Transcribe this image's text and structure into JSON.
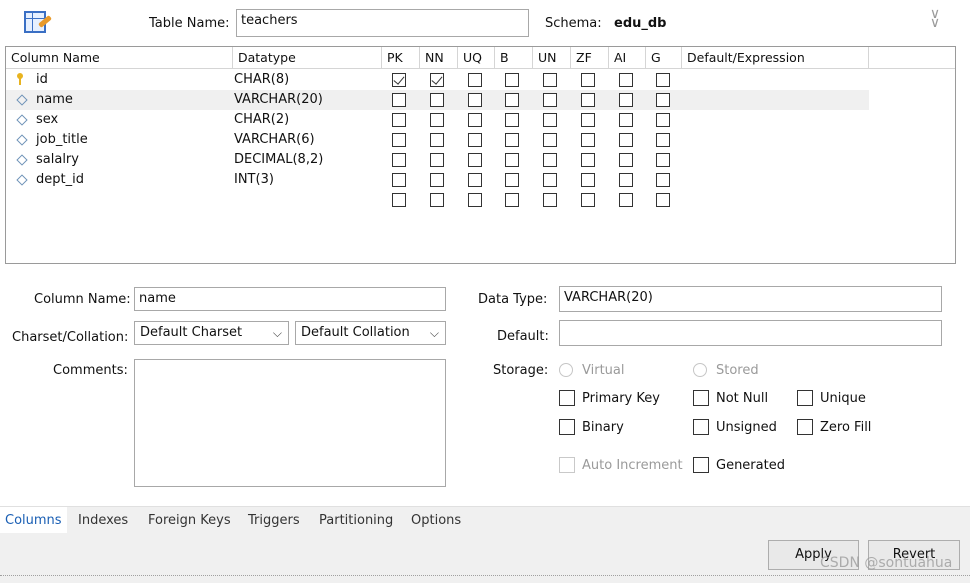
{
  "header": {
    "table_name_label": "Table Name:",
    "table_name_value": "teachers",
    "schema_label": "Schema:",
    "schema_value": "edu_db"
  },
  "grid": {
    "headers": [
      "Column Name",
      "Datatype",
      "PK",
      "NN",
      "UQ",
      "B",
      "UN",
      "ZF",
      "AI",
      "G",
      "Default/Expression"
    ],
    "rows": [
      {
        "icon": "key-icon",
        "name": "id",
        "type": "CHAR(8)",
        "flags": [
          true,
          true,
          false,
          false,
          false,
          false,
          false,
          false
        ]
      },
      {
        "icon": "diamond-icon",
        "name": "name",
        "type": "VARCHAR(20)",
        "flags": [
          false,
          false,
          false,
          false,
          false,
          false,
          false,
          false
        ]
      },
      {
        "icon": "diamond-icon",
        "name": "sex",
        "type": "CHAR(2)",
        "flags": [
          false,
          false,
          false,
          false,
          false,
          false,
          false,
          false
        ]
      },
      {
        "icon": "diamond-icon",
        "name": "job_title",
        "type": "VARCHAR(6)",
        "flags": [
          false,
          false,
          false,
          false,
          false,
          false,
          false,
          false
        ]
      },
      {
        "icon": "diamond-icon",
        "name": "salalry",
        "type": "DECIMAL(8,2)",
        "flags": [
          false,
          false,
          false,
          false,
          false,
          false,
          false,
          false
        ]
      },
      {
        "icon": "diamond-icon",
        "name": "dept_id",
        "type": "INT(3)",
        "flags": [
          false,
          false,
          false,
          false,
          false,
          false,
          false,
          false
        ]
      },
      {
        "icon": "",
        "name": "",
        "type": "",
        "flags": [
          false,
          false,
          false,
          false,
          false,
          false,
          false,
          false
        ]
      }
    ]
  },
  "details": {
    "column_name_label": "Column Name:",
    "column_name_value": "name",
    "charset_label": "Charset/Collation:",
    "charset_value": "Default Charset",
    "collation_value": "Default Collation",
    "comments_label": "Comments:",
    "data_type_label": "Data Type:",
    "data_type_value": "VARCHAR(20)",
    "default_label": "Default:",
    "default_value": "",
    "storage_label": "Storage:",
    "virtual_label": "Virtual",
    "stored_label": "Stored",
    "primary_key_label": "Primary Key",
    "not_null_label": "Not Null",
    "unique_label": "Unique",
    "binary_label": "Binary",
    "unsigned_label": "Unsigned",
    "zero_fill_label": "Zero Fill",
    "auto_increment_label": "Auto Increment",
    "generated_label": "Generated"
  },
  "tabs": [
    "Columns",
    "Indexes",
    "Foreign Keys",
    "Triggers",
    "Partitioning",
    "Options"
  ],
  "active_tab": "Columns",
  "footer": {
    "apply_label": "Apply",
    "revert_label": "Revert"
  },
  "watermark": "CSDN @sontuahua"
}
